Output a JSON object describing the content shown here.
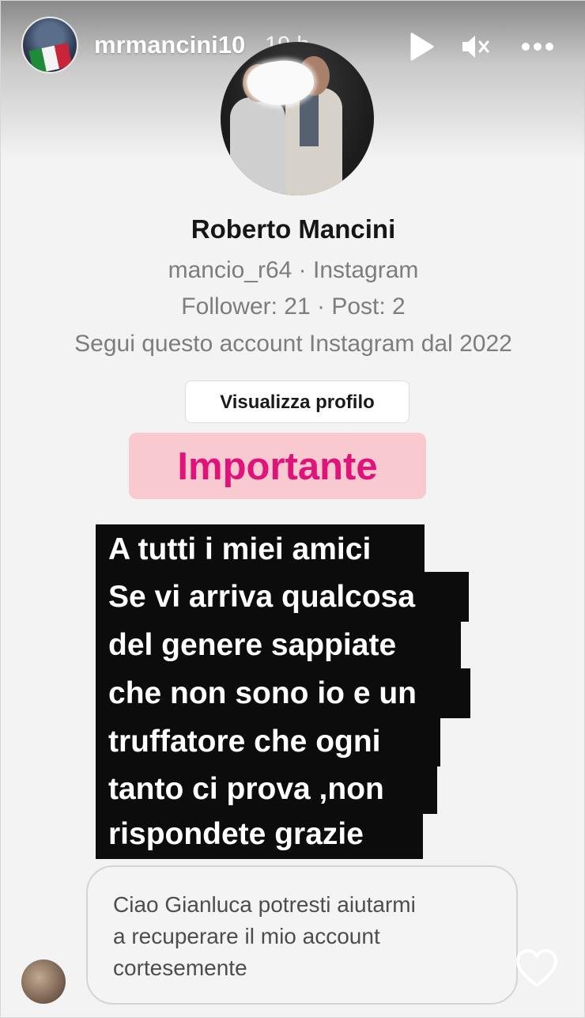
{
  "header": {
    "username": "mrmancini10",
    "time": "19 h",
    "icons": [
      "play-icon",
      "volume-muted-icon",
      "more-icon"
    ]
  },
  "profile_card": {
    "name": "Roberto Mancini",
    "handle_line": "mancio_r64 · Instagram",
    "stats_line": "Follower: 21 · Post: 2",
    "since_line": "Segui questo account Instagram dal 2022",
    "view_profile_label": "Visualizza profilo"
  },
  "sticker": {
    "label": "Importante",
    "text_color": "#e0137a",
    "bg_color": "#f9c9d0"
  },
  "warning": {
    "lines": [
      "A tutti i miei amici",
      "Se vi arriva qualcosa",
      "del genere sappiate",
      "che non sono io e un",
      "truffatore che ogni",
      "tanto ci prova ,non",
      "rispondete grazie"
    ]
  },
  "message": {
    "lines": [
      "Ciao Gianluca potresti aiutarmi",
      "a recuperare il mio account",
      "cortesemente"
    ]
  },
  "footer": {
    "icons": [
      "heart-icon"
    ]
  }
}
